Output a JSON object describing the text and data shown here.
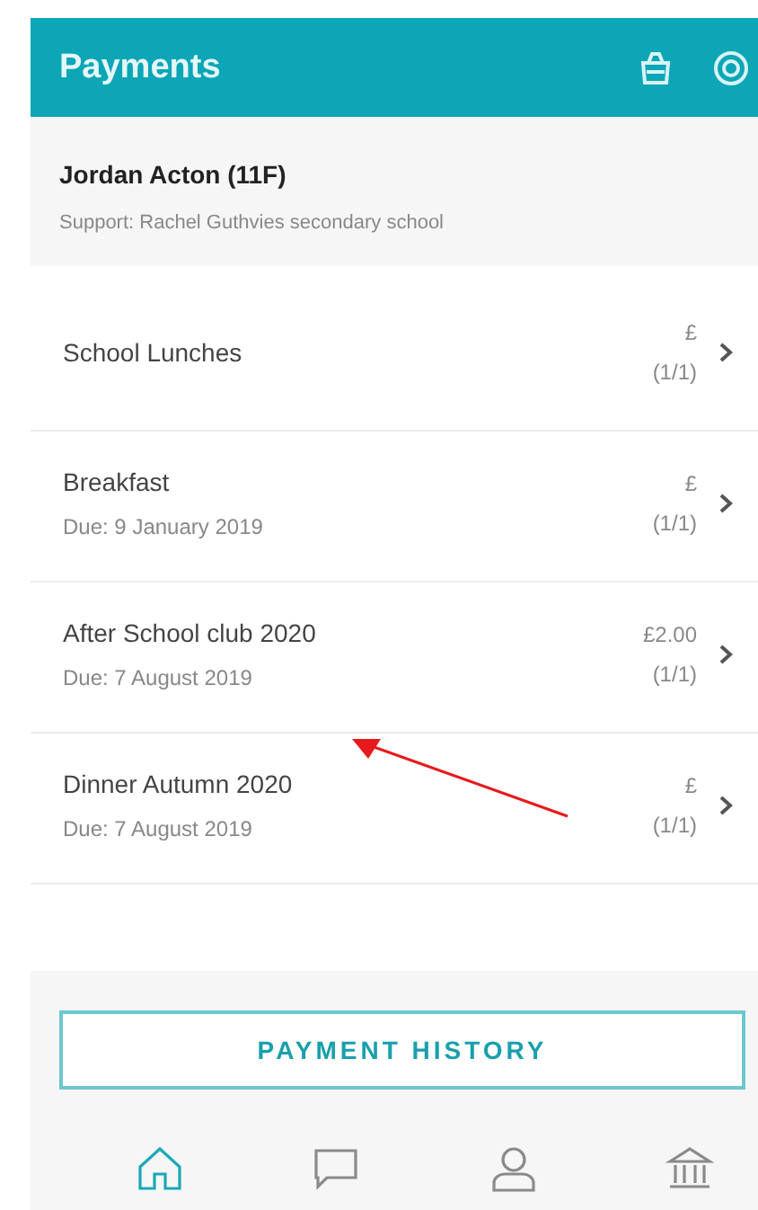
{
  "header": {
    "title": "Payments"
  },
  "student": {
    "name": "Jordan Acton (11F)",
    "support": "Support: Rachel Guthvies secondary school"
  },
  "payments": [
    {
      "title": "School Lunches",
      "amount": "£",
      "count": "(1/1)"
    },
    {
      "title": "Breakfast",
      "due": "Due: 9 January 2019",
      "amount": "£",
      "count": "(1/1)"
    },
    {
      "title": "After School club 2020",
      "due": "Due: 7 August 2019",
      "amount": "£2.00",
      "count": "(1/1)"
    },
    {
      "title": "Dinner Autumn 2020",
      "due": "Due: 7 August 2019",
      "amount": "£",
      "count": "(1/1)"
    }
  ],
  "history_button": "PAYMENT HISTORY",
  "nav": [
    {
      "kind": "home",
      "selected": true
    },
    {
      "kind": "messages",
      "selected": false
    },
    {
      "kind": "profile",
      "selected": false
    },
    {
      "kind": "bank",
      "selected": false
    }
  ],
  "annotations": [
    {
      "kind": "arrow",
      "color": "#e8191a"
    }
  ]
}
